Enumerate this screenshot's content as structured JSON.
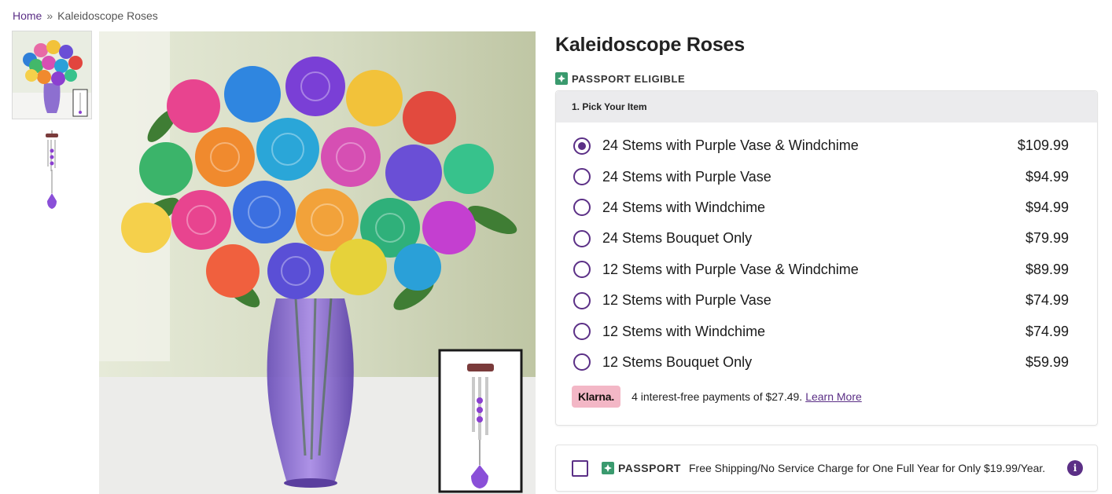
{
  "breadcrumb": {
    "home": "Home",
    "separator": "»",
    "current": "Kaleidoscope Roses"
  },
  "product": {
    "title": "Kaleidoscope Roses",
    "passport_label": "PASSPORT ELIGIBLE"
  },
  "picker": {
    "heading": "1. Pick Your Item",
    "selected_index": 0,
    "options": [
      {
        "label": "24 Stems with Purple Vase & Windchime",
        "price": "$109.99"
      },
      {
        "label": "24 Stems with Purple Vase",
        "price": "$94.99"
      },
      {
        "label": "24 Stems with Windchime",
        "price": "$94.99"
      },
      {
        "label": "24 Stems Bouquet Only",
        "price": "$79.99"
      },
      {
        "label": "12 Stems with Purple Vase & Windchime",
        "price": "$89.99"
      },
      {
        "label": "12 Stems with Purple Vase",
        "price": "$74.99"
      },
      {
        "label": "12 Stems with Windchime",
        "price": "$74.99"
      },
      {
        "label": "12 Stems Bouquet Only",
        "price": "$59.99"
      }
    ]
  },
  "klarna": {
    "badge": "Klarna.",
    "text": "4 interest-free payments of $27.49.",
    "link": "Learn More"
  },
  "passport_offer": {
    "name": "PASSPORT",
    "description": "Free Shipping/No Service Charge for One Full Year for Only $19.99/Year.",
    "info_icon": "i"
  },
  "colors": {
    "accent": "#5b2f86",
    "klarna_pink": "#f3b7c6",
    "passport_green": "#3a9a6e"
  }
}
